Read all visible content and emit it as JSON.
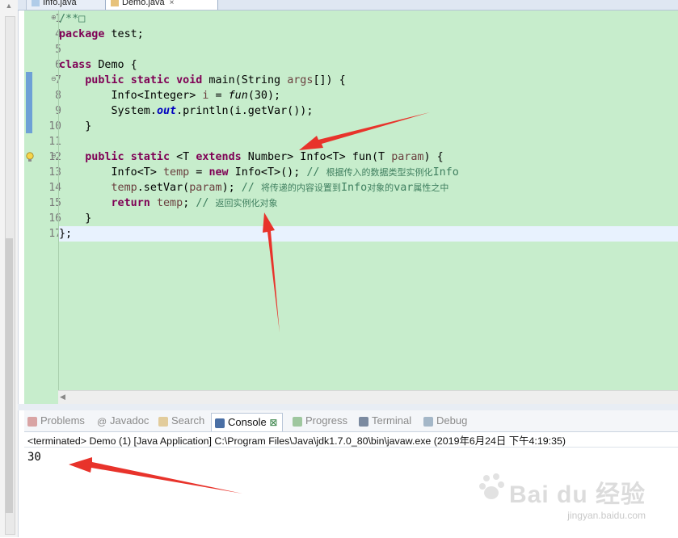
{
  "editor": {
    "tabs": [
      {
        "label": "Info.java",
        "active": false
      },
      {
        "label": "Demo.java",
        "active": true,
        "close": "×"
      }
    ],
    "lines": [
      {
        "num": "1",
        "parts": [
          {
            "t": "/**",
            "c": "cm"
          },
          {
            "t": "□",
            "c": "cm"
          }
        ]
      },
      {
        "num": "4",
        "parts": [
          {
            "t": "package",
            "c": "kw"
          },
          {
            "t": " test;"
          }
        ]
      },
      {
        "num": "5",
        "parts": []
      },
      {
        "num": "6",
        "parts": [
          {
            "t": "class",
            "c": "kw"
          },
          {
            "t": " Demo {"
          }
        ]
      },
      {
        "num": "7",
        "parts": [
          {
            "t": "    "
          },
          {
            "t": "public",
            "c": "kw"
          },
          {
            "t": " "
          },
          {
            "t": "static",
            "c": "kw"
          },
          {
            "t": " "
          },
          {
            "t": "void",
            "c": "kw"
          },
          {
            "t": " main(String "
          },
          {
            "t": "args",
            "c": "pv"
          },
          {
            "t": "[]) {"
          }
        ]
      },
      {
        "num": "8",
        "parts": [
          {
            "t": "        Info<Integer> "
          },
          {
            "t": "i",
            "c": "pv"
          },
          {
            "t": " = "
          },
          {
            "t": "fun",
            "c": "it"
          },
          {
            "t": "(30);"
          }
        ]
      },
      {
        "num": "9",
        "parts": [
          {
            "t": "        System."
          },
          {
            "t": "out",
            "c": "fld"
          },
          {
            "t": ".println(i.getVar());"
          }
        ]
      },
      {
        "num": "10",
        "parts": [
          {
            "t": "    }"
          }
        ]
      },
      {
        "num": "11",
        "parts": []
      },
      {
        "num": "12",
        "parts": [
          {
            "t": "    "
          },
          {
            "t": "public",
            "c": "kw"
          },
          {
            "t": " "
          },
          {
            "t": "static",
            "c": "kw"
          },
          {
            "t": " <T "
          },
          {
            "t": "extends",
            "c": "kw"
          },
          {
            "t": " Number> Info<T> fun(T "
          },
          {
            "t": "param",
            "c": "pv"
          },
          {
            "t": ") {"
          }
        ]
      },
      {
        "num": "13",
        "parts": [
          {
            "t": "        Info<T> "
          },
          {
            "t": "temp",
            "c": "pv"
          },
          {
            "t": " = "
          },
          {
            "t": "new",
            "c": "kw"
          },
          {
            "t": " Info<T>(); "
          },
          {
            "t": "// ",
            "c": "cm"
          },
          {
            "t": "根据传入的数据类型实例化",
            "c": "cmz"
          },
          {
            "t": "Info",
            "c": "cm"
          }
        ]
      },
      {
        "num": "14",
        "parts": [
          {
            "t": "        "
          },
          {
            "t": "temp",
            "c": "pv"
          },
          {
            "t": ".setVar("
          },
          {
            "t": "param",
            "c": "pv"
          },
          {
            "t": "); "
          },
          {
            "t": "// ",
            "c": "cm"
          },
          {
            "t": "将传递的内容设置到",
            "c": "cmz"
          },
          {
            "t": "Info",
            "c": "cm"
          },
          {
            "t": "对象的",
            "c": "cmz"
          },
          {
            "t": "var",
            "c": "cm"
          },
          {
            "t": "属性之中",
            "c": "cmz"
          }
        ]
      },
      {
        "num": "15",
        "parts": [
          {
            "t": "        "
          },
          {
            "t": "return",
            "c": "kw"
          },
          {
            "t": " "
          },
          {
            "t": "temp",
            "c": "pv"
          },
          {
            "t": "; "
          },
          {
            "t": "// ",
            "c": "cm"
          },
          {
            "t": "返回实例化对象",
            "c": "cmz"
          }
        ]
      },
      {
        "num": "16",
        "parts": [
          {
            "t": "    }"
          }
        ]
      },
      {
        "num": "17",
        "parts": [
          {
            "t": "};"
          }
        ]
      }
    ]
  },
  "views": {
    "tabs": [
      "Problems",
      "Javadoc",
      "Search",
      "Console",
      "Progress",
      "Terminal",
      "Debug"
    ],
    "active": "Console",
    "console_close": "⊠",
    "status": "<terminated> Demo (1) [Java Application] C:\\Program Files\\Java\\jdk1.7.0_80\\bin\\javaw.exe (2019年6月24日 下午4:19:35)",
    "output": "30"
  },
  "watermark": {
    "brand": "Bai du 经验",
    "url": "jingyan.baidu.com"
  },
  "colors": {
    "editor_bg": "#c7edcc",
    "keyword": "#7f0055",
    "comment": "#3f7f5f",
    "arrow": "#e8332b"
  }
}
